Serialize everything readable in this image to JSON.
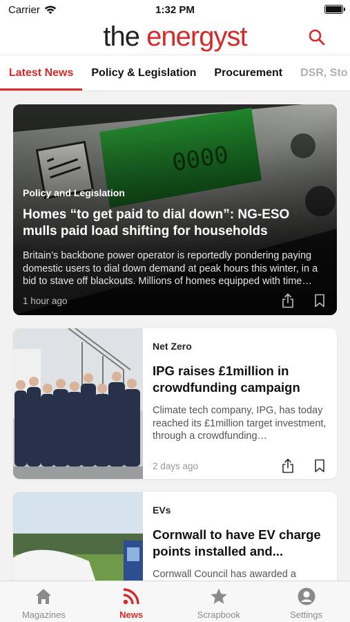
{
  "status": {
    "carrier": "Carrier",
    "time": "1:32 PM"
  },
  "header": {
    "brand_the": "the",
    "brand_energyst": "energyst",
    "search_icon": "search-icon"
  },
  "tabs": [
    {
      "label": "Latest News",
      "active": true
    },
    {
      "label": "Policy & Legislation",
      "active": false
    },
    {
      "label": "Procurement",
      "active": false
    },
    {
      "label": "DSR, Sto",
      "active": false
    }
  ],
  "hero": {
    "category": "Policy and Legislation",
    "title": "Homes “to get paid to dial down”: NG-ESO mulls paid load shifting for households",
    "summary": "Britain’s backbone power operator is reportedly pondering paying domestic users to dial down demand at peak hours this winter, in a bid to stave off blackouts. Millions of homes equipped with time…",
    "time": "1 hour ago",
    "meter_display": "0000"
  },
  "articles": [
    {
      "category": "Net Zero",
      "title": "IPG raises £1million in crowdfunding campaign",
      "summary": "Climate tech company, IPG, has today reached its £1million target investment, through a crowdfunding…",
      "time": "2 days ago"
    },
    {
      "category": "EVs",
      "title": "Cornwall to have EV charge points installed and...",
      "summary": "Cornwall Council has awarded a",
      "time": ""
    }
  ],
  "tabbar": [
    {
      "label": "Magazines",
      "icon": "home-icon",
      "active": false
    },
    {
      "label": "News",
      "icon": "rss-icon",
      "active": true
    },
    {
      "label": "Scrapbook",
      "icon": "star-icon",
      "active": false
    },
    {
      "label": "Settings",
      "icon": "person-icon",
      "active": false
    }
  ],
  "colors": {
    "brand_red": "#d42a2a",
    "text_dark": "#111111",
    "muted": "#999999"
  }
}
